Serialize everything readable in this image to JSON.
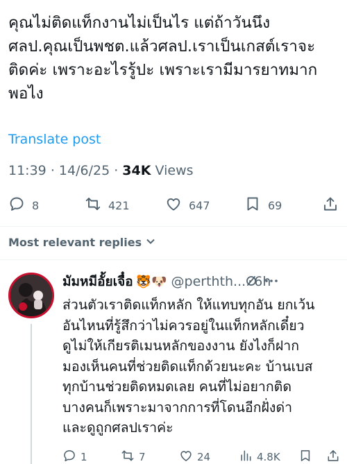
{
  "tweet": {
    "text": "คุณไม่ติดแท็กงานไม่เป็นไร แต่ถ้าวันนึง\nศลป.คุณเป็นพชต.แล้วศลป.เราเป็นเกสต์เราจะ\nติดค่ะ เพราะอะไรรู้ปะ เพราะเรามีมารยาทมาก\nพอไง",
    "translate_label": "Translate post",
    "time": "11:39",
    "separator": "·",
    "date": "14/6/25",
    "views_count": "34K",
    "views_label": "Views",
    "actions": {
      "replies": "8",
      "reposts": "421",
      "likes": "647",
      "bookmarks": "69"
    }
  },
  "replies_sort": {
    "label": "Most relevant replies"
  },
  "reply": {
    "name": "มัมหมีอั้ยเจื๋อ",
    "emojis": "🐯🐶",
    "handle": "@perthth...",
    "dot": "·",
    "time": "6h",
    "text": "ส่วนตัวเราติดแท็กหลัก ให้แทบทุกอัน ยกเว้น\nอันไหนที่รู้สึกว่าไม่ควรอยู่ในแท็กหลักเดี๋ยว\nดูไม่ให้เกียรติเมนหลักของงาน ยังไงก็ฝาก\nมองเห็นคนที่ช่วยติดแท็กด้วยนะคะ บ้านเบส\nทุกบ้านช่วยติดหมดเลย คนที่ไม่อยากติด\nบางคนก็เพราะมาจากการที่โดนอีกฝั่งด่า\nและดูถูกศลปเราค่ะ",
    "actions": {
      "replies": "1",
      "reposts": "7",
      "likes": "24",
      "views": "4.8K"
    }
  },
  "colors": {
    "link": "#1d9bf0",
    "secondary_text": "#536471",
    "primary_text": "#0f1419",
    "divider": "#eff3f4"
  }
}
